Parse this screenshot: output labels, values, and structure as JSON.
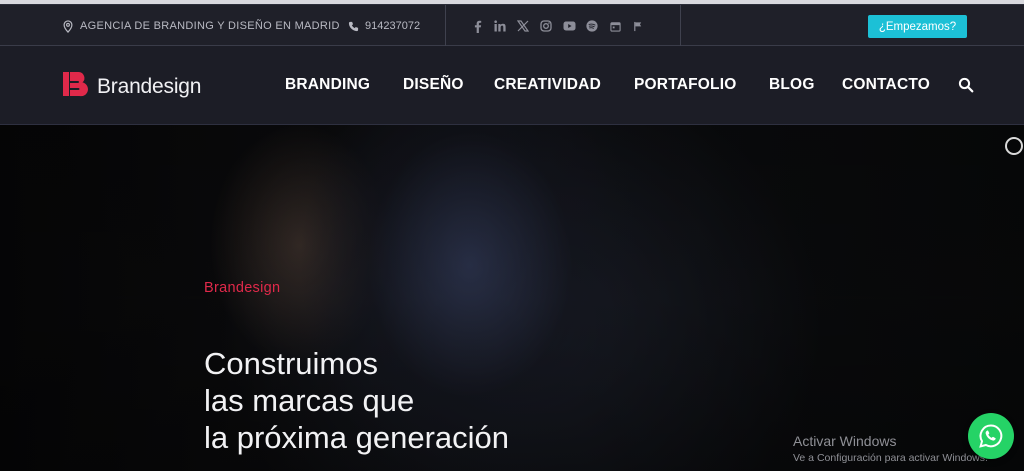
{
  "topbar": {
    "location_text": "AGENCIA DE BRANDING Y DISEÑO EN MADRID",
    "phone_text": "914237072",
    "social_icons": [
      "facebook-icon",
      "linkedin-icon",
      "x-icon",
      "instagram-icon",
      "youtube-icon",
      "spotify-icon",
      "calendar-icon",
      "flag-icon"
    ],
    "cta_label": "¿Empezamos?"
  },
  "nav": {
    "logo_text": "Brandesign",
    "items": [
      "BRANDING",
      "DISEÑO",
      "CREATIVIDAD",
      "PORTAFOLIO",
      "BLOG",
      "CONTACTO"
    ]
  },
  "hero": {
    "eyebrow": "Brandesign",
    "headline_lines": [
      "Construimos",
      "las marcas que",
      "la próxima generación"
    ]
  },
  "overlay": {
    "activate_title": "Activar Windows",
    "activate_subtitle": "Ve a Configuración para activar Windows."
  },
  "colors": {
    "accent_red": "#e0294a",
    "cta_cyan": "#1cc0d6",
    "whatsapp_green": "#25d366",
    "nav_bg": "#1c1d26"
  }
}
